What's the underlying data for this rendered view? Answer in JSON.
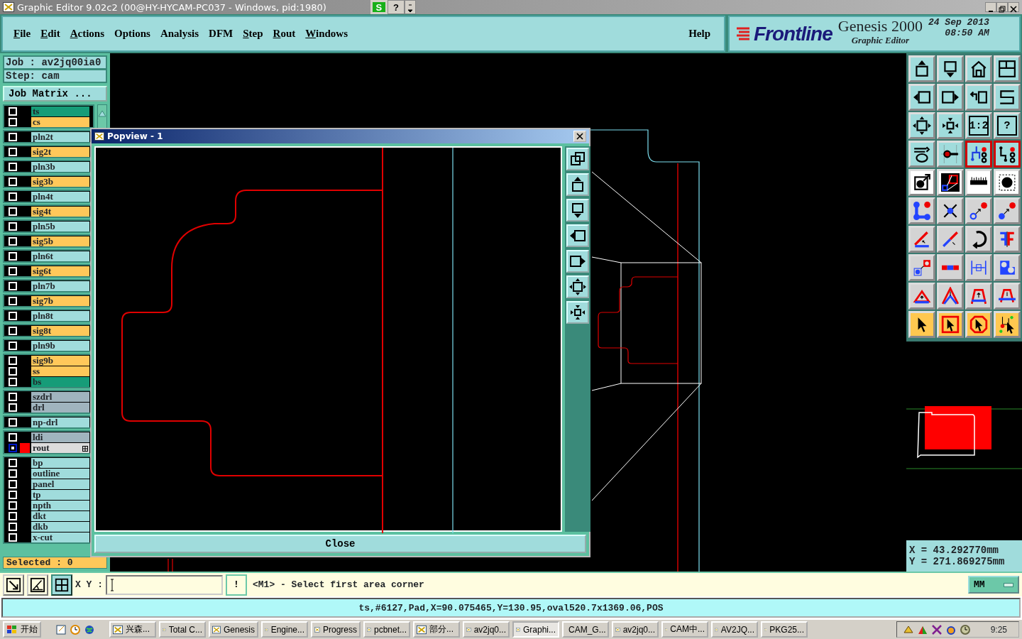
{
  "window": {
    "title": "Graphic Editor 9.02c2 (00@HY-HYCAM-PC037 - Windows, pid:1980)"
  },
  "title_toolbar": {
    "buttons": [
      "S",
      "?"
    ]
  },
  "menu": [
    {
      "label": "File",
      "underlined": true
    },
    {
      "label": "Edit",
      "underlined": true
    },
    {
      "label": "Actions",
      "underlined": true
    },
    {
      "label": "Options",
      "underlined": false
    },
    {
      "label": "Analysis",
      "underlined": false
    },
    {
      "label": "DFM",
      "underlined": false
    },
    {
      "label": "Step",
      "underlined": true
    },
    {
      "label": "Rout",
      "underlined": true
    },
    {
      "label": "Windows",
      "underlined": true
    }
  ],
  "help": "Help",
  "brand": {
    "logo": "Frontline",
    "product": "Genesis 2000",
    "subtitle": "Graphic Editor",
    "date": "24 Sep 2013",
    "time": "08:50 AM"
  },
  "job": {
    "job": "Job : av2jq00ia0",
    "step": "Step: cam",
    "matrix_button": "Job Matrix ..."
  },
  "layer_groups": [
    {
      "layers": [
        {
          "name": "ts",
          "color": "#169c78",
          "selected": false
        },
        {
          "name": "cs",
          "color": "#ffc85a",
          "selected": false
        }
      ]
    },
    {
      "layers": [
        {
          "name": "pln2t",
          "color": "#a0dcdc",
          "selected": false
        }
      ]
    },
    {
      "layers": [
        {
          "name": "sig2t",
          "color": "#ffc85a",
          "selected": false
        }
      ]
    },
    {
      "layers": [
        {
          "name": "pln3b",
          "color": "#a0dcdc",
          "selected": false
        }
      ]
    },
    {
      "layers": [
        {
          "name": "sig3b",
          "color": "#ffc85a",
          "selected": false
        }
      ]
    },
    {
      "layers": [
        {
          "name": "pln4t",
          "color": "#a0dcdc",
          "selected": false
        }
      ]
    },
    {
      "layers": [
        {
          "name": "sig4t",
          "color": "#ffc85a",
          "selected": false
        }
      ]
    },
    {
      "layers": [
        {
          "name": "pln5b",
          "color": "#a0dcdc",
          "selected": false
        }
      ]
    },
    {
      "layers": [
        {
          "name": "sig5b",
          "color": "#ffc85a",
          "selected": false
        }
      ]
    },
    {
      "layers": [
        {
          "name": "pln6t",
          "color": "#a0dcdc",
          "selected": false
        }
      ]
    },
    {
      "layers": [
        {
          "name": "sig6t",
          "color": "#ffc85a",
          "selected": false
        }
      ]
    },
    {
      "layers": [
        {
          "name": "pln7b",
          "color": "#a0dcdc",
          "selected": false
        }
      ]
    },
    {
      "layers": [
        {
          "name": "sig7b",
          "color": "#ffc85a",
          "selected": false
        }
      ]
    },
    {
      "layers": [
        {
          "name": "pln8t",
          "color": "#a0dcdc",
          "selected": false
        }
      ]
    },
    {
      "layers": [
        {
          "name": "sig8t",
          "color": "#ffc85a",
          "selected": false
        }
      ]
    },
    {
      "layers": [
        {
          "name": "pln9b",
          "color": "#a0dcdc",
          "selected": false
        }
      ]
    },
    {
      "layers": [
        {
          "name": "sig9b",
          "color": "#ffc85a",
          "selected": false
        },
        {
          "name": "ss",
          "color": "#ffc85a",
          "selected": false
        },
        {
          "name": "bs",
          "color": "#169c78",
          "selected": false
        }
      ]
    },
    {
      "layers": [
        {
          "name": "szdrl",
          "color": "#a0b4be",
          "selected": false
        },
        {
          "name": "drl",
          "color": "#a0b4be",
          "selected": false
        }
      ]
    },
    {
      "layers": [
        {
          "name": "np-drl",
          "color": "#a0dcdc",
          "selected": false
        }
      ]
    },
    {
      "layers": [
        {
          "name": "ldi",
          "color": "#a0b4be",
          "selected": false
        },
        {
          "name": "rout",
          "color": "#dcdcdc",
          "selected": true
        }
      ]
    },
    {
      "layers": [
        {
          "name": "bp",
          "color": "#a0dcdc",
          "selected": false
        },
        {
          "name": "outline",
          "color": "#a0dcdc",
          "selected": false
        },
        {
          "name": "panel",
          "color": "#a0dcdc",
          "selected": false
        },
        {
          "name": "tp",
          "color": "#a0dcdc",
          "selected": false
        },
        {
          "name": "npth",
          "color": "#a0dcdc",
          "selected": false
        },
        {
          "name": "dkt",
          "color": "#a0dcdc",
          "selected": false
        },
        {
          "name": "dkb",
          "color": "#a0dcdc",
          "selected": false
        },
        {
          "name": "x-cut",
          "color": "#a0dcdc",
          "selected": false
        }
      ]
    }
  ],
  "selected_count": "Selected : 0",
  "popview": {
    "title": "Popview - 1",
    "close_button": "Close"
  },
  "toolbar": [
    {
      "kind": "view",
      "highlighted": false
    },
    {
      "kind": "view",
      "highlighted": false
    },
    {
      "kind": "view",
      "highlighted": false
    },
    {
      "kind": "view",
      "highlighted": false
    },
    {
      "kind": "view",
      "highlighted": false
    },
    {
      "kind": "view",
      "highlighted": false
    },
    {
      "kind": "view",
      "highlighted": false
    },
    {
      "kind": "view",
      "highlighted": false
    },
    {
      "kind": "view",
      "highlighted": false
    },
    {
      "kind": "view",
      "highlighted": false
    },
    {
      "kind": "view",
      "highlighted": false,
      "label": "1:2"
    },
    {
      "kind": "view",
      "highlighted": false,
      "label": "?"
    },
    {
      "kind": "view",
      "highlighted": false
    },
    {
      "kind": "view",
      "highlighted": false
    },
    {
      "kind": "view",
      "highlighted": true
    },
    {
      "kind": "view",
      "highlighted": true
    },
    {
      "kind": "mode",
      "highlighted": false
    },
    {
      "kind": "mode",
      "highlighted": false
    },
    {
      "kind": "mode",
      "highlighted": false
    },
    {
      "kind": "mode",
      "highlighted": false
    },
    {
      "kind": "edit",
      "highlighted": false
    },
    {
      "kind": "edit",
      "highlighted": false
    },
    {
      "kind": "edit",
      "highlighted": false
    },
    {
      "kind": "edit",
      "highlighted": false
    },
    {
      "kind": "edit",
      "highlighted": false
    },
    {
      "kind": "edit",
      "highlighted": false
    },
    {
      "kind": "edit",
      "highlighted": false
    },
    {
      "kind": "edit",
      "highlighted": false
    },
    {
      "kind": "edit",
      "highlighted": false
    },
    {
      "kind": "edit",
      "highlighted": false
    },
    {
      "kind": "edit",
      "highlighted": false
    },
    {
      "kind": "edit",
      "highlighted": false
    },
    {
      "kind": "edit",
      "highlighted": false
    },
    {
      "kind": "edit",
      "highlighted": false
    },
    {
      "kind": "edit",
      "highlighted": false
    },
    {
      "kind": "edit",
      "highlighted": false
    },
    {
      "kind": "select",
      "highlighted": false
    },
    {
      "kind": "select",
      "highlighted": false
    },
    {
      "kind": "select",
      "highlighted": false
    },
    {
      "kind": "select",
      "highlighted": false
    }
  ],
  "coordinates": {
    "x": "X = 43.292770mm",
    "y": "Y = 271.869275mm"
  },
  "command": {
    "label": "X Y :",
    "confirm_button": "!",
    "prompt": "<M1> - Select first area corner",
    "units": "MM"
  },
  "status_line": "ts,#6127,Pad,X=90.075465,Y=130.95,oval520.7x1369.06,POS",
  "taskbar": {
    "start": "开始",
    "tasks": [
      {
        "label": "兴森...",
        "selected": false
      },
      {
        "label": "Total C...",
        "selected": false
      },
      {
        "label": "Genesis",
        "selected": false
      },
      {
        "label": "Engine...",
        "selected": false
      },
      {
        "label": "Progress",
        "selected": false
      },
      {
        "label": "pcbnet...",
        "selected": false
      },
      {
        "label": "部分...",
        "selected": false
      },
      {
        "label": "av2jq0...",
        "selected": false
      },
      {
        "label": "Graphi...",
        "selected": true
      },
      {
        "label": "CAM_G...",
        "selected": false
      },
      {
        "label": "av2jq0...",
        "selected": false
      },
      {
        "label": "CAM中...",
        "selected": false
      },
      {
        "label": "AV2JQ...",
        "selected": false
      },
      {
        "label": "PKG25...",
        "selected": false
      }
    ],
    "clock": "9:25"
  }
}
